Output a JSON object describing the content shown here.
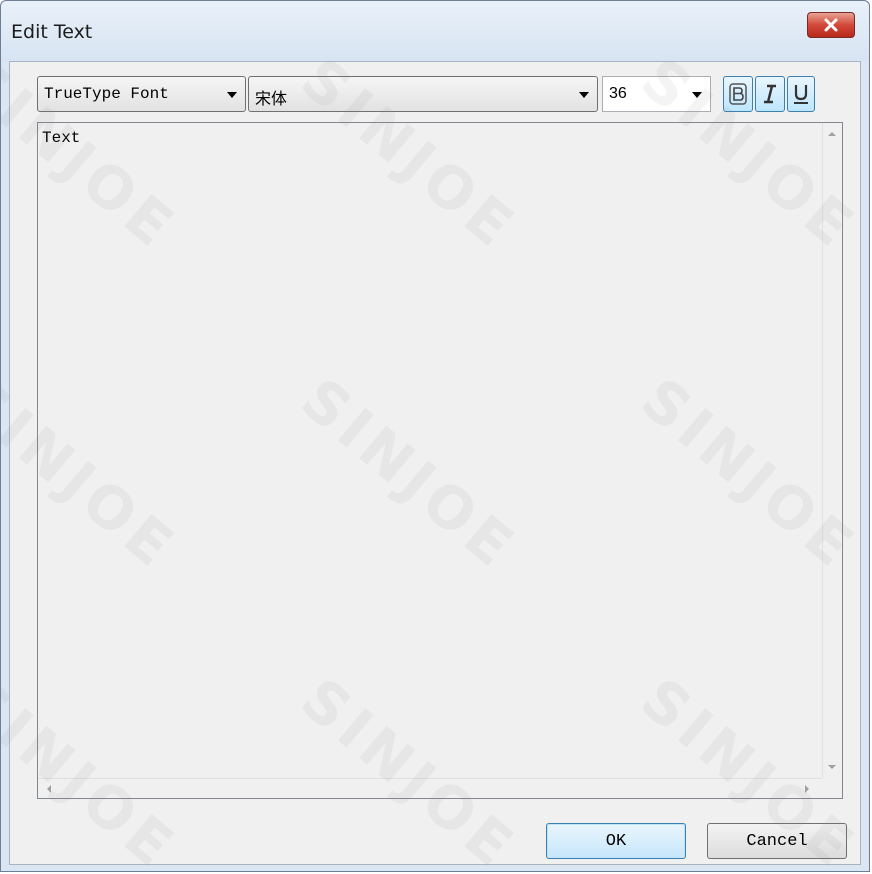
{
  "window": {
    "title": "Edit Text"
  },
  "toolbar": {
    "font_type": "TrueType Font",
    "font_name": "宋体",
    "font_size": "36",
    "bold_icon": "bold-icon",
    "italic_icon": "italic-icon",
    "underline_icon": "underline-icon"
  },
  "editor": {
    "content": "Text"
  },
  "buttons": {
    "ok": "OK",
    "cancel": "Cancel"
  },
  "watermark": {
    "text": "SINJOE"
  },
  "colors": {
    "close_button": "#d2493a",
    "toggle_button": "#bde6fd",
    "frame": "#dbe6f3"
  }
}
